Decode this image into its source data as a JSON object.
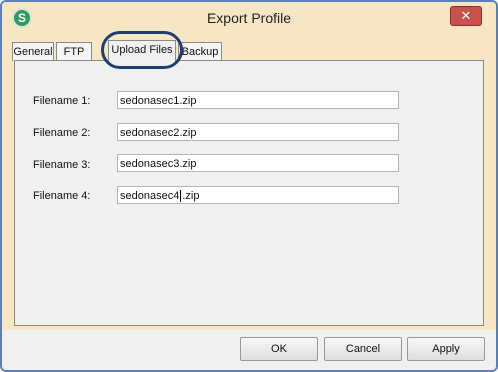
{
  "window": {
    "title": "Export Profile",
    "close_label": "✕",
    "icon_label": "S"
  },
  "tabs": [
    {
      "label": "General"
    },
    {
      "label": "FTP"
    },
    {
      "label": "Upload Files"
    },
    {
      "label": "Backup"
    }
  ],
  "fields": [
    {
      "label": "Filename 1:",
      "value": "sedonasec1.zip"
    },
    {
      "label": "Filename 2:",
      "value": "sedonasec2.zip"
    },
    {
      "label": "Filename 3:",
      "value": "sedonasec3.zip"
    },
    {
      "label": "Filename 4:",
      "value_before_caret": "sedonasec4",
      "value_after_caret": ".zip"
    }
  ],
  "buttons": {
    "ok": "OK",
    "cancel": "Cancel",
    "apply": "Apply"
  },
  "colors": {
    "highlight": "#1d3e6f",
    "title_bg": "#f6e6c4",
    "close": "#c7514b"
  }
}
